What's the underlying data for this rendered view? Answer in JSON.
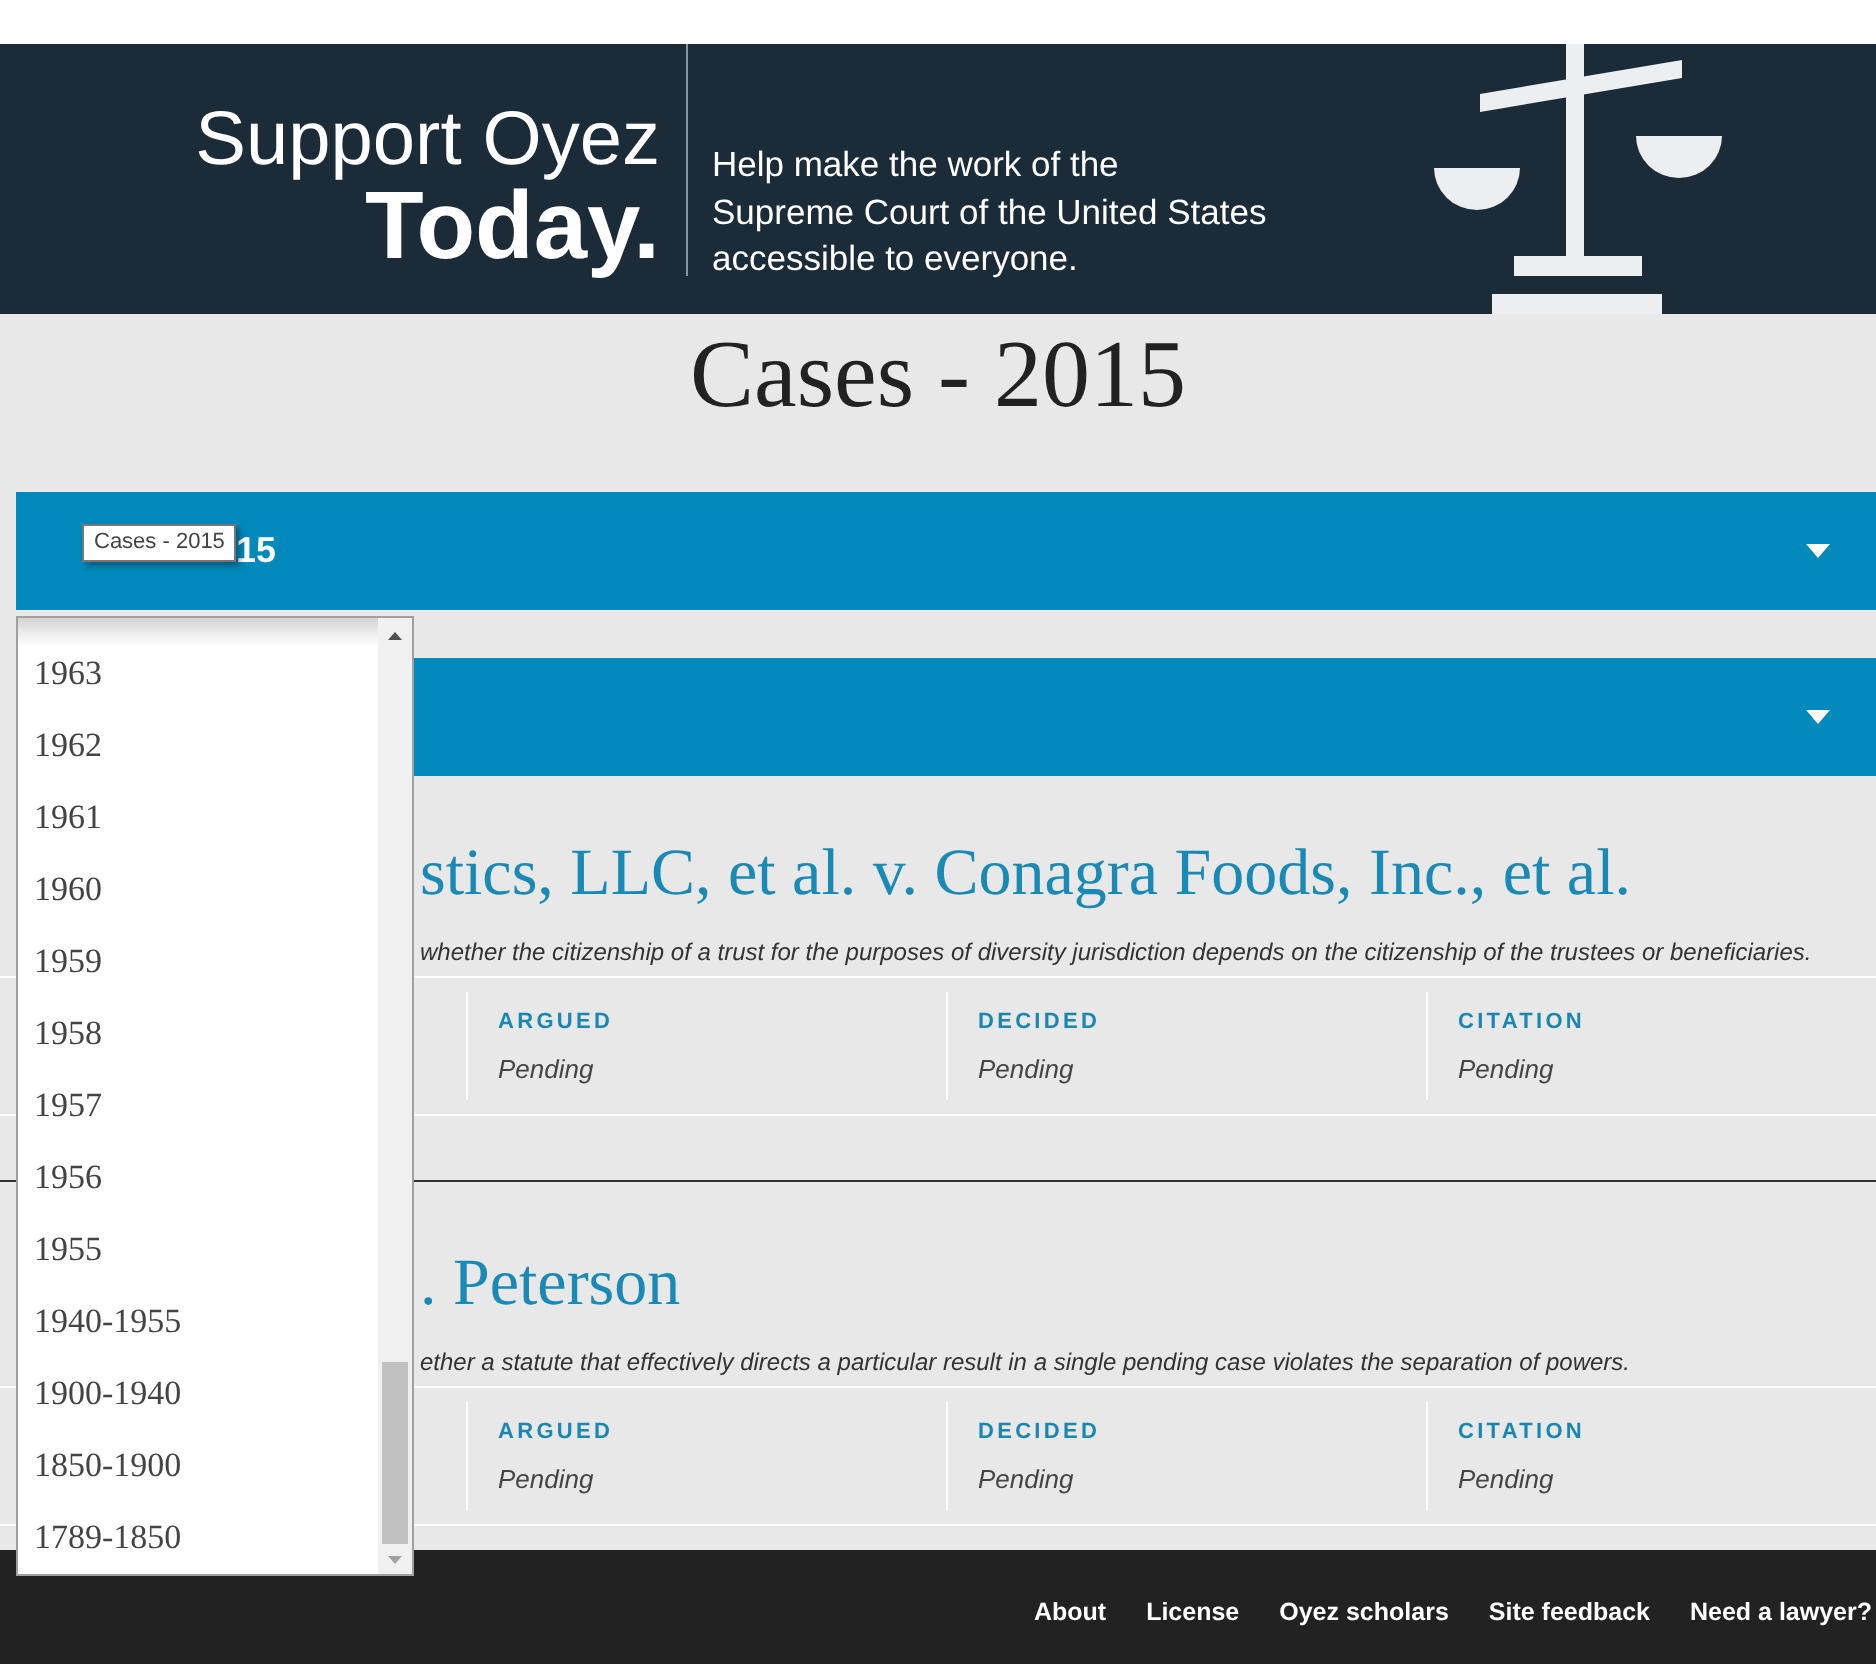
{
  "banner": {
    "headline": "Support Oyez",
    "headline_emphasis": "Today.",
    "message_lines": [
      "Help make the work of the",
      "Supreme Court of the United States",
      "accessible to everyone."
    ]
  },
  "page_title": "Cases - 2015",
  "filter_bars": [
    {
      "label": "15",
      "expanded": false
    },
    {
      "expanded": false
    }
  ],
  "tooltip": {
    "text": "Cases - 2015"
  },
  "year_dropdown": {
    "options": [
      {
        "label": "1963",
        "selected": false
      },
      {
        "label": "1962",
        "selected": false
      },
      {
        "label": "1961",
        "selected": false
      },
      {
        "label": "1960",
        "selected": false
      },
      {
        "label": "1959",
        "selected": false
      },
      {
        "label": "1958",
        "selected": false
      },
      {
        "label": "1957",
        "selected": false
      },
      {
        "label": "1956",
        "selected": false
      },
      {
        "label": "1955",
        "selected": false
      },
      {
        "label": "1940-1955",
        "selected": false
      },
      {
        "label": "1900-1940",
        "selected": false
      },
      {
        "label": "1850-1900",
        "selected": false
      },
      {
        "label": "1789-1850",
        "selected": false
      }
    ]
  },
  "cases": [
    {
      "title": "stics, LLC, et al. v. Conagra Foods, Inc., et al.",
      "description": "whether the citizenship of a trust for the purposes of diversity jurisdiction depends on the citizenship of the trustees or beneficiaries.",
      "fields": [
        {
          "label": "ARGUED",
          "value": "Pending"
        },
        {
          "label": "DECIDED",
          "value": "Pending"
        },
        {
          "label": "CITATION",
          "value": "Pending"
        }
      ]
    },
    {
      "title": ". Peterson",
      "description": "ether a statute that effectively directs a particular result in a single pending case violates the separation of powers.",
      "fields": [
        {
          "label": "ARGUED",
          "value": "Pending"
        },
        {
          "label": "DECIDED",
          "value": "Pending"
        },
        {
          "label": "CITATION",
          "value": "Pending"
        }
      ]
    }
  ],
  "footer": {
    "links": [
      "About",
      "License",
      "Oyez scholars",
      "Site feedback",
      "Need a lawyer?"
    ]
  }
}
